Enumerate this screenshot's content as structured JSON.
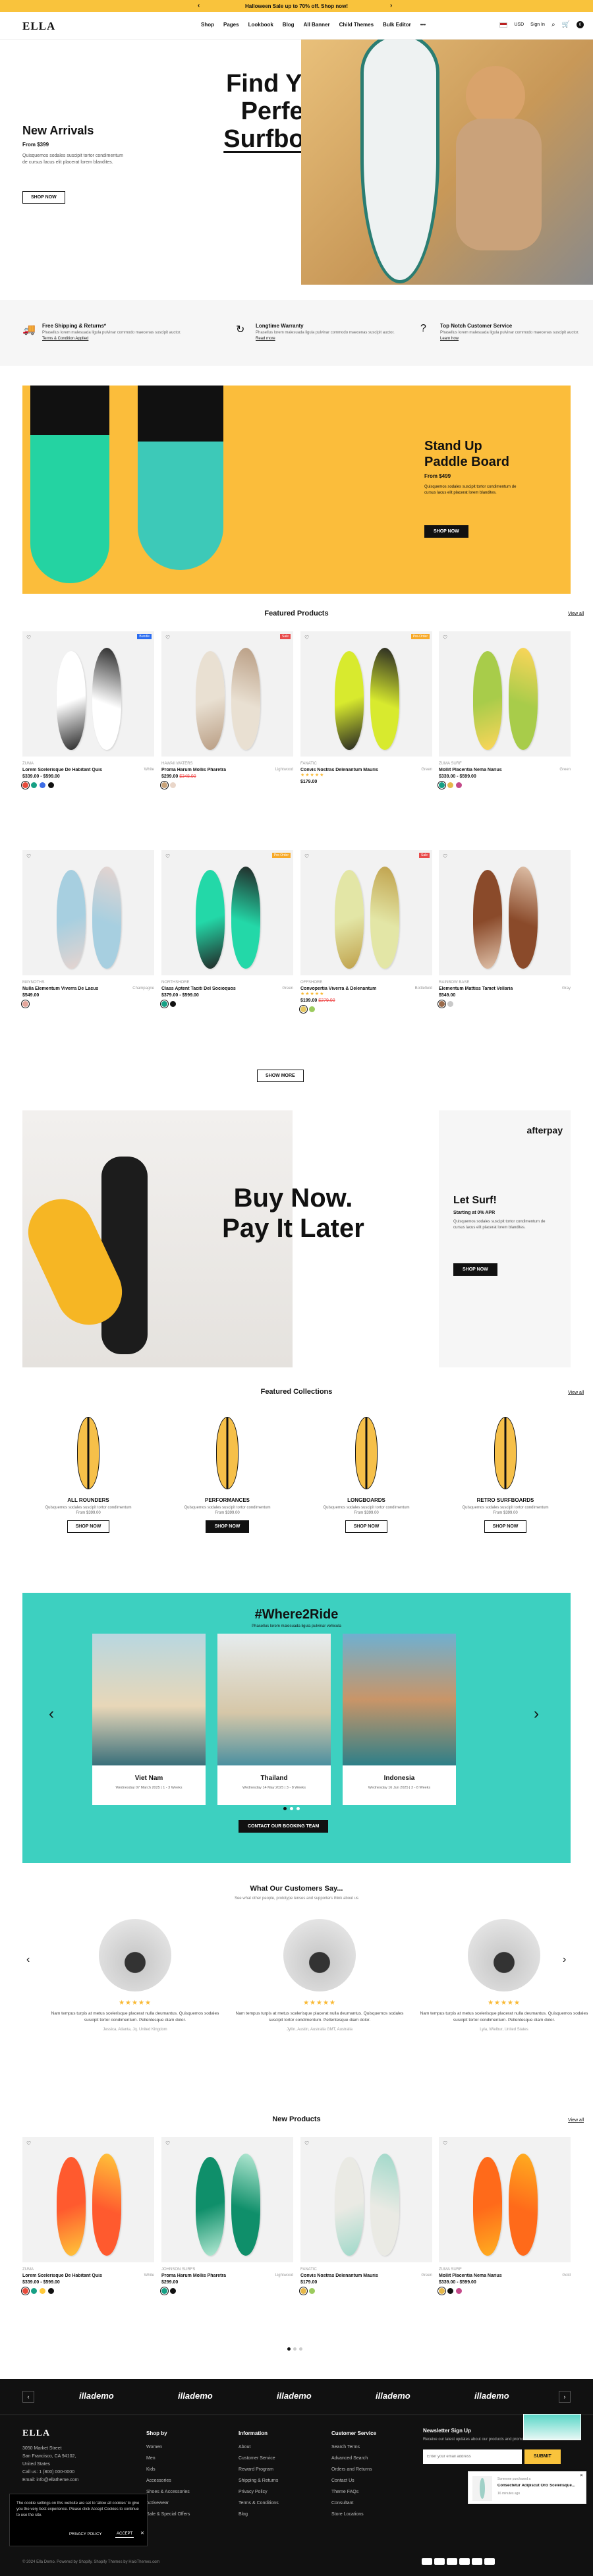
{
  "promo": {
    "text": "Halloween Sale up to 70% off. Shop now!"
  },
  "header": {
    "logo": "ELLA",
    "nav": [
      "Shop",
      "Pages",
      "Lookbook",
      "Blog",
      "All Banner",
      "Child Themes",
      "Bulk Editor"
    ],
    "more": "•••",
    "currency": "USD",
    "signin": "Sign In",
    "cart_count": "0"
  },
  "hero": {
    "left_title": "New Arrivals",
    "left_price": "From $399",
    "left_desc": "Quisquemos sodales suscipit tortor condimentum de cursus lacus elit placerat lorem blandites.",
    "left_btn": "SHOP NOW",
    "big_line1": "Find Your",
    "big_line2": "Perfect",
    "big_line3": "Surfboard"
  },
  "services": [
    {
      "title": "Free Shipping & Returns*",
      "desc": "Phasellus lorem malesuada ligula pulvinar commodo maecenas suscipit auctor.",
      "link": "Terms & Condition Applied"
    },
    {
      "title": "Longtime Warranty",
      "desc": "Phasellus lorem malesuada ligula pulvinar commodo maecenas suscipit auctor.",
      "link": "Read more"
    },
    {
      "title": "Top Notch Customer Service",
      "desc": "Phasellus lorem malesuada ligula pulvinar commodo maecenas suscipit auctor.",
      "link": "Learn how"
    }
  ],
  "sup": {
    "title1": "Stand Up",
    "title2": "Paddle Board",
    "price": "From $499",
    "desc": "Quisquemos sodales suscipit tortor condimentum de cursus lacus elit placerat lorem blandites.",
    "btn": "SHOP NOW"
  },
  "featured": {
    "title": "Featured Products",
    "view_all": "View all",
    "show_more": "SHOW MORE",
    "products": [
      {
        "vendor": "ZUMA",
        "name": "Lorem Scelerisque De Habitant Quis",
        "tag": "White",
        "price": "$339.00 - $599.00",
        "old": "",
        "badge": "Bundle",
        "badgeColor": "#2a6cf0",
        "c1": "#ffffff",
        "c2": "#222222",
        "swatches": [
          "#e74c3c",
          "#16a085",
          "#3d6de6",
          "#111111"
        ]
      },
      {
        "vendor": "HAWAII WATERS",
        "name": "Proma Harum Mollis Pharetra",
        "tag": "Lightwood",
        "price": "$299.00",
        "old": "$348.00",
        "badge": "Sale",
        "badgeColor": "#e84a4a",
        "c1": "#e9e0d2",
        "c2": "#b89c82",
        "swatches": [
          "#c8a37a",
          "#e9d6c9"
        ]
      },
      {
        "vendor": "FANATIC",
        "name": "Convis Nostras Delenantum Mauris",
        "tag": "Green",
        "price": "$179.00",
        "old": "",
        "badge": "Pre-Order",
        "badgeColor": "#f7a928",
        "c1": "#d8ea2e",
        "c2": "#222222",
        "swatches": [],
        "stars": true
      },
      {
        "vendor": "ZUMA SURF",
        "name": "Mollit Placentia Nema Narius",
        "tag": "Green",
        "price": "$339.00 - $599.00",
        "old": "",
        "badge": "",
        "badgeColor": "",
        "c1": "#a8cc4a",
        "c2": "#ffd65a",
        "swatches": [
          "#16a085",
          "#e6b84a",
          "#c44a8a"
        ]
      },
      {
        "vendor": "MAYNOTHS",
        "name": "Nulla Elementum Viverra De Lacus",
        "tag": "Champagne",
        "price": "$549.00",
        "old": "",
        "badge": "",
        "badgeColor": "",
        "c1": "#a7cfe0",
        "c2": "#e7d4cf",
        "swatches": [
          "#e3a59a"
        ]
      },
      {
        "vendor": "NORTHSHORE",
        "name": "Class Aptent Taciti Del Socioquos",
        "tag": "Green",
        "price": "$379.00 - $599.00",
        "old": "",
        "badge": "Pre-Order",
        "badgeColor": "#f7a928",
        "c1": "#23d8a8",
        "c2": "#222222",
        "swatches": [
          "#16a085",
          "#111111"
        ]
      },
      {
        "vendor": "OFFSHORE",
        "name": "Convopertia Viverra & Delenantum",
        "tag": "Bottlefield",
        "price": "$199.00",
        "old": "$279.00",
        "badge": "Sale",
        "badgeColor": "#e84a4a",
        "c1": "#e3e6a6",
        "c2": "#bfa04a",
        "swatches": [
          "#e6c760",
          "#9ccb5e"
        ],
        "stars": true
      },
      {
        "vendor": "RAINBOW BASE",
        "name": "Elementum Mattiss Tamet Vellaria",
        "tag": "Gray",
        "price": "$549.00",
        "old": "",
        "badge": "",
        "badgeColor": "",
        "c1": "#8a4a2a",
        "c2": "#e2c5ad",
        "swatches": [
          "#9a6a4a",
          "#c9c9c9"
        ]
      }
    ]
  },
  "bnpl": {
    "big1": "Buy Now.",
    "big2": "Pay It Later",
    "brand": "afterpay",
    "title": "Let Surf!",
    "sub": "Starting at 0% APR",
    "desc": "Quisquemos sodales suscipit tortor condimentum de cursus lacus elit placerat lorem blandites.",
    "btn": "SHOP NOW"
  },
  "collections": {
    "title": "Featured Collections",
    "view_all": "View all",
    "items": [
      {
        "name": "ALL ROUNDERS",
        "desc": "Quisquemos sodales suscipit tortor condimentum",
        "count": "From $399.00",
        "btn": "SHOP NOW",
        "dark": false
      },
      {
        "name": "PERFORMANCES",
        "desc": "Quisquemos sodales suscipit tortor condimentum",
        "count": "From $399.00",
        "btn": "SHOP NOW",
        "dark": true
      },
      {
        "name": "LONGBOARDS",
        "desc": "Quisquemos sodales suscipit tortor condimentum",
        "count": "From $399.00",
        "btn": "SHOP NOW",
        "dark": false
      },
      {
        "name": "RETRO SURFBOARDS",
        "desc": "Quisquemos sodales suscipit tortor condimentum",
        "count": "From $399.00",
        "btn": "SHOP NOW",
        "dark": false
      }
    ]
  },
  "where": {
    "title": "#Where2Ride",
    "sub": "Phasellus lorem malesuada ligula pulvinar vehicula",
    "btn": "CONTACT OUR BOOKING TEAM",
    "trips": [
      {
        "name": "Viet Nam",
        "meta": "Wednesday 07 March 2025 | 1 - 3 Weeks"
      },
      {
        "name": "Thailand",
        "meta": "Wednesday 14 May 2025 | 3 - 8 Weeks"
      },
      {
        "name": "Indonesia",
        "meta": "Wednesday 16 Jun 2025 | 3 - 8 Weeks"
      }
    ]
  },
  "testimonials": {
    "title": "What Our Customers Say...",
    "sub": "See what other people, prototype lenses and supporters think about us",
    "items": [
      {
        "text": "Nam tempus turpis at metus scelerisque placerat nulla deumantus. Quisquemos sodales suscipit tortor condimentum. Pellentesque diam dolor.",
        "author": "Jessica, Atlanta, Jq. United Kingdom"
      },
      {
        "text": "Nam tempus turpis at metus scelerisque placerat nulla deumantus. Quisquemos sodales suscipit tortor condimentum. Pellentesque diam dolor.",
        "author": "Jyllin, Austin, Australia GMT, Australia"
      },
      {
        "text": "Nam tempus turpis at metus scelerisque placerat nulla deumantus. Quisquemos sodales suscipit tortor condimentum. Pellentesque diam dolor.",
        "author": "Lyla, Wielbur, United States"
      }
    ]
  },
  "new_products": {
    "title": "New Products",
    "view_all": "View all",
    "products": [
      {
        "vendor": "ZUMA",
        "name": "Lorem Scelerisque De Habitant Quis",
        "tag": "White",
        "price": "$339.00 - $599.00",
        "c1": "#ff5a2e",
        "c2": "#ffc93a",
        "swatches": [
          "#e74c3c",
          "#16a085",
          "#ffc93a",
          "#111111"
        ]
      },
      {
        "vendor": "JOHNSON SURFS",
        "name": "Proma Harum Mollis Pharetra",
        "tag": "Lightwood",
        "price": "$299.00",
        "c1": "#0f8f6a",
        "c2": "#b9ecd7",
        "swatches": [
          "#16a085",
          "#111111"
        ]
      },
      {
        "vendor": "FANATIC",
        "name": "Convis Nostras Delenantum Mauris",
        "tag": "Green",
        "price": "$179.00",
        "c1": "#eaeae4",
        "c2": "#9ed8c9",
        "swatches": [
          "#e6b84a",
          "#9ccb5e"
        ]
      },
      {
        "vendor": "ZUMA SURF",
        "name": "Mollit Placentia Nema Narius",
        "tag": "Gold",
        "price": "$339.00 - $599.00",
        "c1": "#ff6a1a",
        "c2": "#ffb020",
        "swatches": [
          "#e6b84a",
          "#111111",
          "#c44a8a"
        ]
      }
    ]
  },
  "brands": [
    "illademo",
    "illademo",
    "illademo",
    "illademo",
    "illademo"
  ],
  "footer": {
    "logo": "ELLA",
    "address": [
      "3050 Market Street",
      "San Francisco, CA 94102,",
      "United States",
      "Call us: 1 (800) 000-0000",
      "Email: info@ellatheme.com"
    ],
    "col1": {
      "title": "Shop by",
      "links": [
        "Women",
        "Men",
        "Kids",
        "Accessories",
        "Shoes & Accessories",
        "Activewear",
        "Sale & Special Offers"
      ]
    },
    "col2": {
      "title": "Information",
      "links": [
        "About",
        "Customer Service",
        "Reward Program",
        "Shipping & Returns",
        "Privacy Policy",
        "Terms & Conditions",
        "Blog"
      ]
    },
    "col3": {
      "title": "Customer Service",
      "links": [
        "Search Terms",
        "Advanced Search",
        "Orders and Returns",
        "Contact Us",
        "Theme FAQs",
        "Consultant",
        "Store Locations"
      ]
    },
    "news_title": "Newsletter Sign Up",
    "news_desc": "Receive our latest updates about our products and promotions.",
    "news_placeholder": "Enter your email address",
    "news_btn": "SUBMIT",
    "copyright": "© 2024 Ella Demo. Powered by Shopify. Shopify Themes by HaloThemes.com"
  },
  "cookie": {
    "text": "The cookie settings on this website are set to 'allow all cookies' to give you the very best experience. Please click Accept Cookies to continue to use the site.",
    "policy": "PRIVACY POLICY",
    "accept": "ACCEPT"
  },
  "toast": {
    "line1": "Someone purchased a",
    "line2": "Consectetur Adipiscut Orci Scelerisque...",
    "line3": "16 minutes ago"
  }
}
